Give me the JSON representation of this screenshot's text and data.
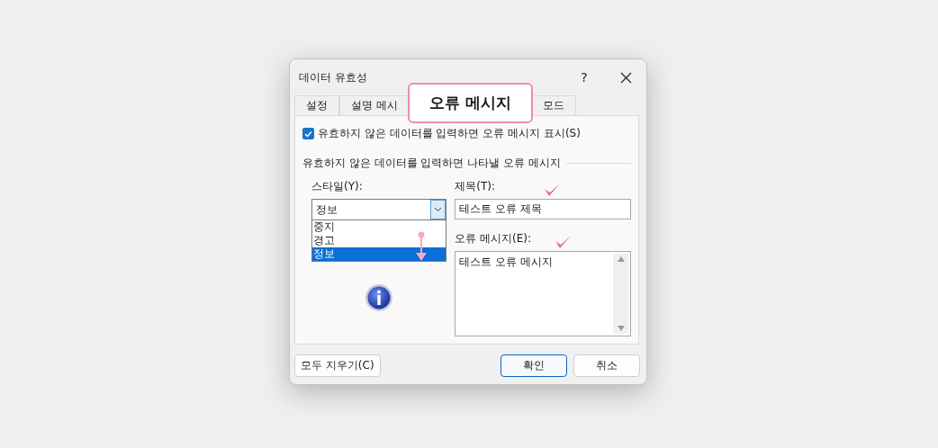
{
  "window": {
    "title": "데이터 유효성",
    "help": "?"
  },
  "tabs": [
    {
      "label": "설정",
      "selected": false
    },
    {
      "label": "설명 메시",
      "selected": false
    },
    {
      "label": "오류 메시지",
      "selected": true
    },
    {
      "label": "모드",
      "selected": false
    }
  ],
  "show_error_checkbox": {
    "label": "유효하지 않은 데이터를 입력하면 오류 메시지 표시(S)",
    "checked": true
  },
  "group_title": "유효하지 않은 데이터를 입력하면 나타낼 오류 메시지",
  "style": {
    "label": "스타일(Y):",
    "value": "정보",
    "options": [
      {
        "label": "중지",
        "selected": false
      },
      {
        "label": "경고",
        "selected": false
      },
      {
        "label": "정보",
        "selected": true
      }
    ]
  },
  "title_field": {
    "label": "제목(T):",
    "value": "테스트 오류 제목"
  },
  "message_field": {
    "label": "오류 메시지(E):",
    "value": "테스트 오류 메시지"
  },
  "buttons": [
    {
      "label": "모두 지우기(C)",
      "kind": "secondary"
    },
    {
      "label": "확인",
      "kind": "default"
    },
    {
      "label": "취소",
      "kind": "secondary"
    }
  ]
}
